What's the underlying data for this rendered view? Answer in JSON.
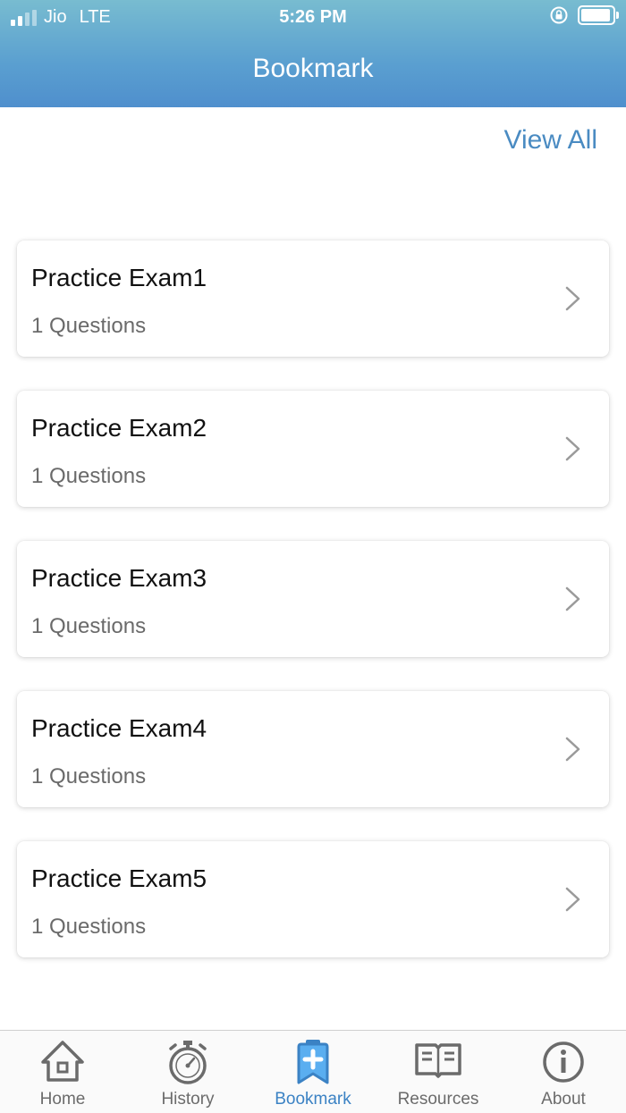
{
  "status_bar": {
    "carrier": "Jio",
    "network": "LTE",
    "time": "5:26 PM"
  },
  "header": {
    "title": "Bookmark"
  },
  "actions": {
    "view_all": "View All"
  },
  "exams": [
    {
      "name": "Practice Exam1",
      "count": "1 Questions"
    },
    {
      "name": "Practice Exam2",
      "count": "1 Questions"
    },
    {
      "name": "Practice Exam3",
      "count": "1 Questions"
    },
    {
      "name": "Practice Exam4",
      "count": "1 Questions"
    },
    {
      "name": "Practice Exam5",
      "count": "1 Questions"
    }
  ],
  "tabs": [
    {
      "label": "Home",
      "icon": "home-icon"
    },
    {
      "label": "History",
      "icon": "stopwatch-icon"
    },
    {
      "label": "Bookmark",
      "icon": "bookmark-icon",
      "active": true
    },
    {
      "label": "Resources",
      "icon": "book-icon"
    },
    {
      "label": "About",
      "icon": "info-icon"
    }
  ],
  "colors": {
    "accent": "#3b82c4",
    "header_top": "#78bcd0",
    "header_bottom": "#4f8fcd"
  }
}
